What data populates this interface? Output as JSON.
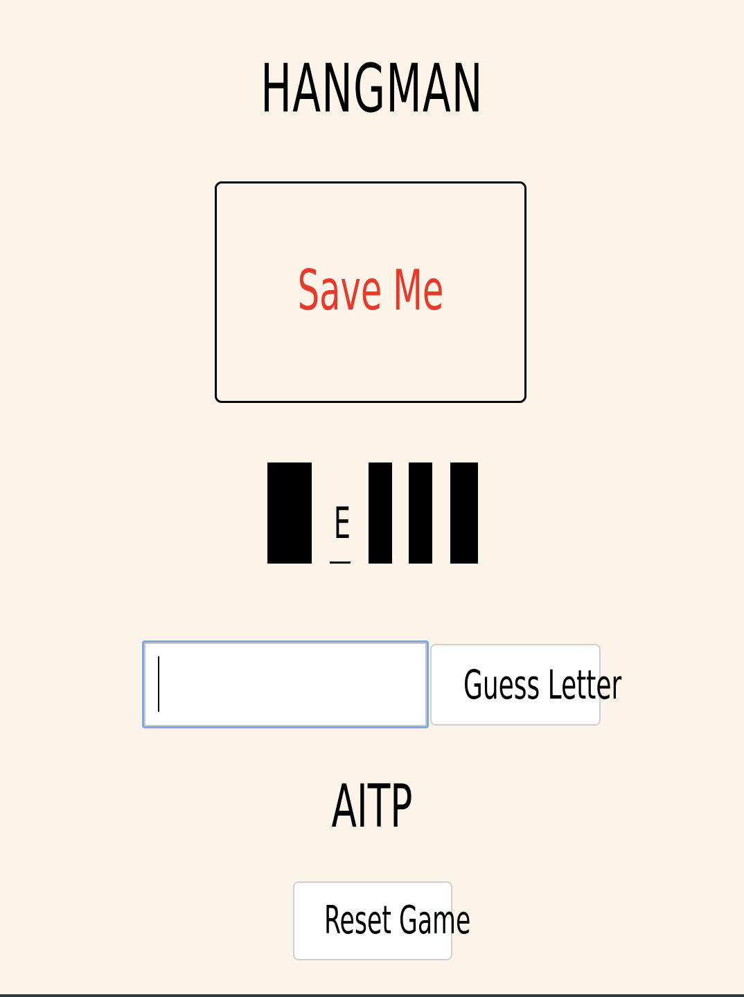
{
  "game": {
    "title": "HANGMAN",
    "panel_message": "Save Me",
    "panel_color": "#e8392a",
    "word_slots": [
      {
        "revealed": false,
        "letter": ""
      },
      {
        "revealed": true,
        "letter": "E"
      },
      {
        "revealed": false,
        "letter": ""
      },
      {
        "revealed": false,
        "letter": ""
      },
      {
        "revealed": false,
        "letter": ""
      }
    ],
    "guess_input_value": "",
    "guess_button_label": "Guess Letter",
    "guessed_letters": "AITP",
    "reset_button_label": "Reset Game"
  }
}
